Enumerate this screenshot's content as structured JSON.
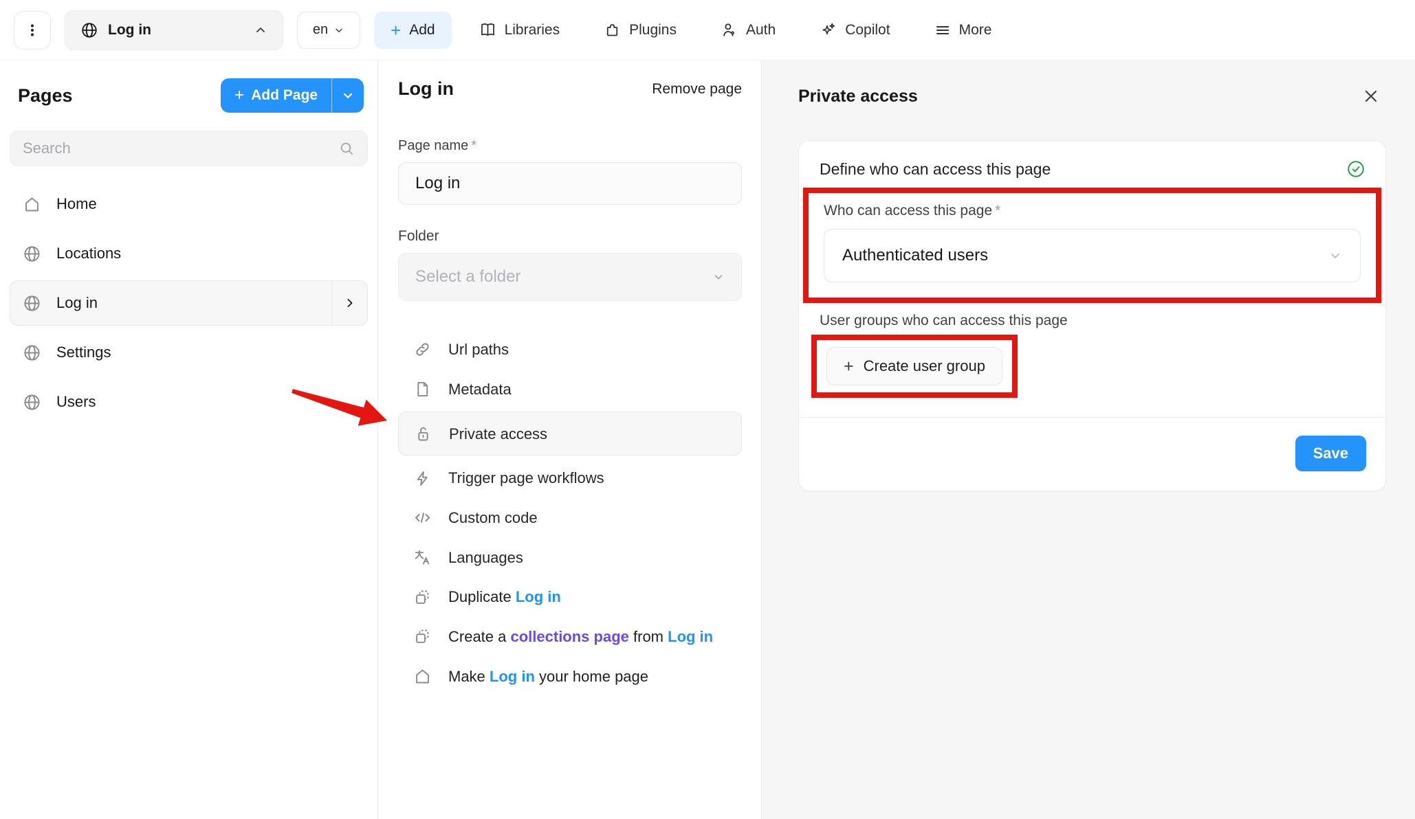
{
  "topbar": {
    "page_selector_label": "Log in",
    "language": "en",
    "add_label": "Add",
    "nav": [
      {
        "label": "Libraries",
        "icon": "book-icon"
      },
      {
        "label": "Plugins",
        "icon": "puzzle-icon"
      },
      {
        "label": "Auth",
        "icon": "person-icon"
      },
      {
        "label": "Copilot",
        "icon": "sparkles-icon"
      },
      {
        "label": "More",
        "icon": "menu-icon"
      }
    ]
  },
  "sidebar": {
    "title": "Pages",
    "add_page_label": "Add Page",
    "search_placeholder": "Search",
    "items": [
      {
        "label": "Home",
        "icon": "home-icon",
        "selected": false
      },
      {
        "label": "Locations",
        "icon": "globe-icon",
        "selected": false
      },
      {
        "label": "Log in",
        "icon": "globe-icon",
        "selected": true
      },
      {
        "label": "Settings",
        "icon": "globe-icon",
        "selected": false
      },
      {
        "label": "Users",
        "icon": "globe-icon",
        "selected": false
      }
    ]
  },
  "page_settings": {
    "title": "Log in",
    "remove_label": "Remove page",
    "page_name_label": "Page name",
    "required_marker": "*",
    "page_name_value": "Log in",
    "folder_label": "Folder",
    "folder_placeholder": "Select a folder",
    "options": [
      {
        "icon": "link-icon",
        "segments": [
          {
            "text": "Url paths"
          }
        ]
      },
      {
        "icon": "file-icon",
        "segments": [
          {
            "text": "Metadata"
          }
        ]
      },
      {
        "icon": "lock-open-icon",
        "highlighted": true,
        "segments": [
          {
            "text": "Private access"
          }
        ]
      },
      {
        "icon": "bolt-icon",
        "segments": [
          {
            "text": "Trigger page workflows"
          }
        ]
      },
      {
        "icon": "code-icon",
        "segments": [
          {
            "text": "Custom code"
          }
        ]
      },
      {
        "icon": "translate-icon",
        "segments": [
          {
            "text": "Languages"
          }
        ]
      },
      {
        "icon": "duplicate-icon",
        "segments": [
          {
            "text": "Duplicate "
          },
          {
            "text": "Log in",
            "style": "blue"
          }
        ]
      },
      {
        "icon": "duplicate-icon",
        "segments": [
          {
            "text": "Create a "
          },
          {
            "text": "collections page",
            "style": "purple"
          },
          {
            "text": " from "
          },
          {
            "text": "Log in",
            "style": "blue"
          }
        ]
      },
      {
        "icon": "home-icon",
        "segments": [
          {
            "text": "Make "
          },
          {
            "text": "Log in",
            "style": "blue"
          },
          {
            "text": " your home page"
          }
        ]
      }
    ]
  },
  "private_access_panel": {
    "title": "Private access",
    "section_heading": "Define who can access this page",
    "access_label": "Who can access this page",
    "access_value": "Authenticated users",
    "groups_label": "User groups who can access this page",
    "create_group_label": "Create user group",
    "save_label": "Save"
  },
  "colors": {
    "accent_blue": "#2493fb",
    "accent_blue_light": "#e8f3fe",
    "annotation_red": "#e3170f",
    "link_blue": "#2093f5",
    "link_purple": "#6d49dd",
    "success_green": "#22a044"
  }
}
